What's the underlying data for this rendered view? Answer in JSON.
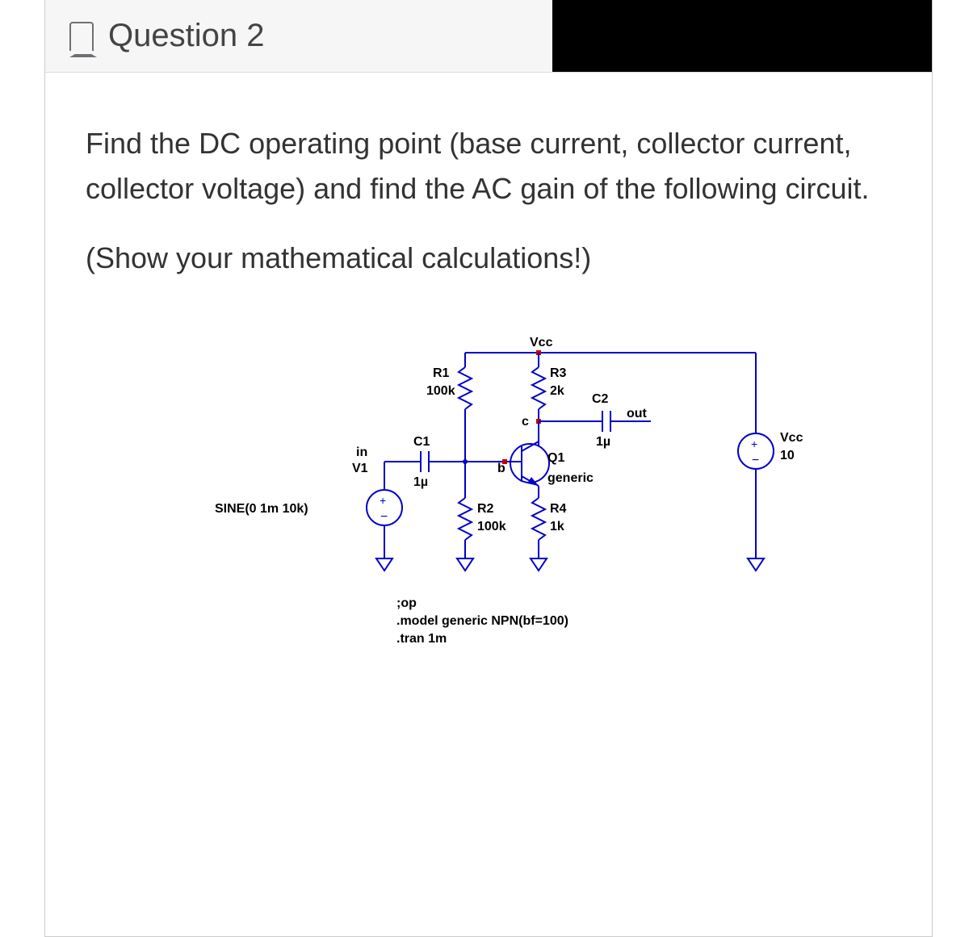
{
  "header": {
    "title": "Question 2"
  },
  "body": {
    "p1": "Find the DC operating point (base current, collector current, collector voltage) and find the AC gain of the following circuit.",
    "p2": "(Show your mathematical calculations!)"
  },
  "circuit": {
    "vcc_label": "Vcc",
    "r1_name": "R1",
    "r1_val": "100k",
    "r2_name": "R2",
    "r2_val": "100k",
    "r3_name": "R3",
    "r3_val": "2k",
    "r4_name": "R4",
    "r4_val": "1k",
    "c1_name": "C1",
    "c1_val": "1µ",
    "c2_name": "C2",
    "c2_val": "1µ",
    "q1_name": "Q1",
    "q1_model": "generic",
    "v1_name": "V1",
    "v1_sine": "SINE(0 1m 10k)",
    "vcc_src_name": "Vcc",
    "vcc_src_val": "10",
    "net_in": "in",
    "net_b": "b",
    "net_c": "c",
    "net_out": "out",
    "dir_op": ";op",
    "dir_model": ".model generic NPN(bf=100)",
    "dir_tran": ".tran 1m"
  }
}
